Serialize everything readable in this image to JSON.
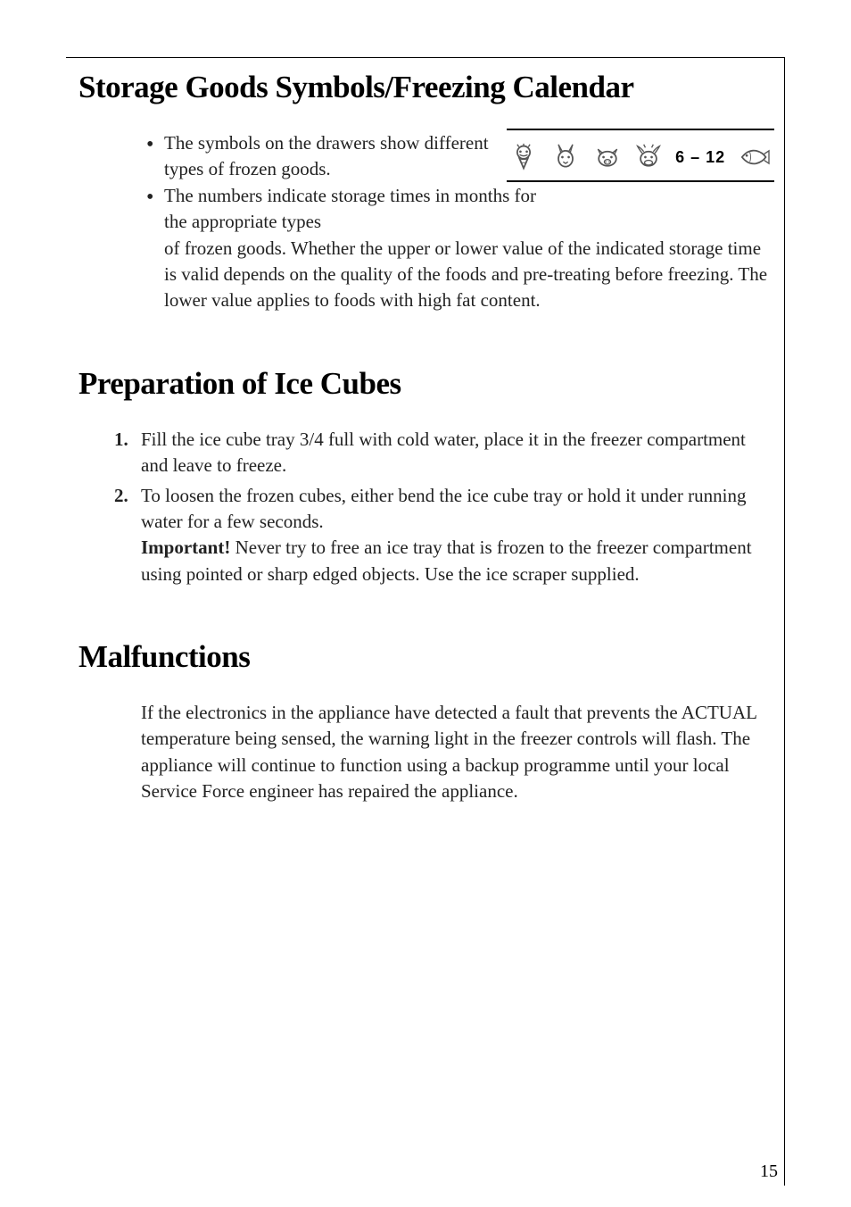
{
  "section1": {
    "heading": "Storage Goods Symbols/Freezing Calendar",
    "bullet1": "The symbols on the drawers show different types of frozen goods.",
    "bullet2_part1": "The numbers indicate storage times in months for the appropriate types",
    "bullet2_part2": "of frozen goods. Whether the upper or lower value of the indicated storage time is valid depends on the quality of the foods and pre-treating before freezing. The lower value applies to foods with high fat content.",
    "icons_label": "6 – 12"
  },
  "section2": {
    "heading": "Preparation of Ice Cubes",
    "item1_num": "1.",
    "item1_text": "Fill the ice cube tray 3/4 full with cold water, place it in the freezer compartment and leave to freeze.",
    "item2_num": "2.",
    "item2_text": "To loosen the frozen cubes, either bend the ice cube tray or hold it under running water for a few seconds.",
    "important_label": "Important!",
    "important_text": " Never try to free an ice tray that is frozen to the freezer compartment using pointed or sharp edged objects. Use the ice scraper supplied."
  },
  "section3": {
    "heading": "Malfunctions",
    "paragraph": "If the electronics in the appliance have detected a fault that prevents the ACTUAL temperature being sensed, the warning light in the freezer controls will flash. The appliance will continue to function using a backup programme until your local Service Force engineer has repaired the appliance."
  },
  "page_number": "15"
}
